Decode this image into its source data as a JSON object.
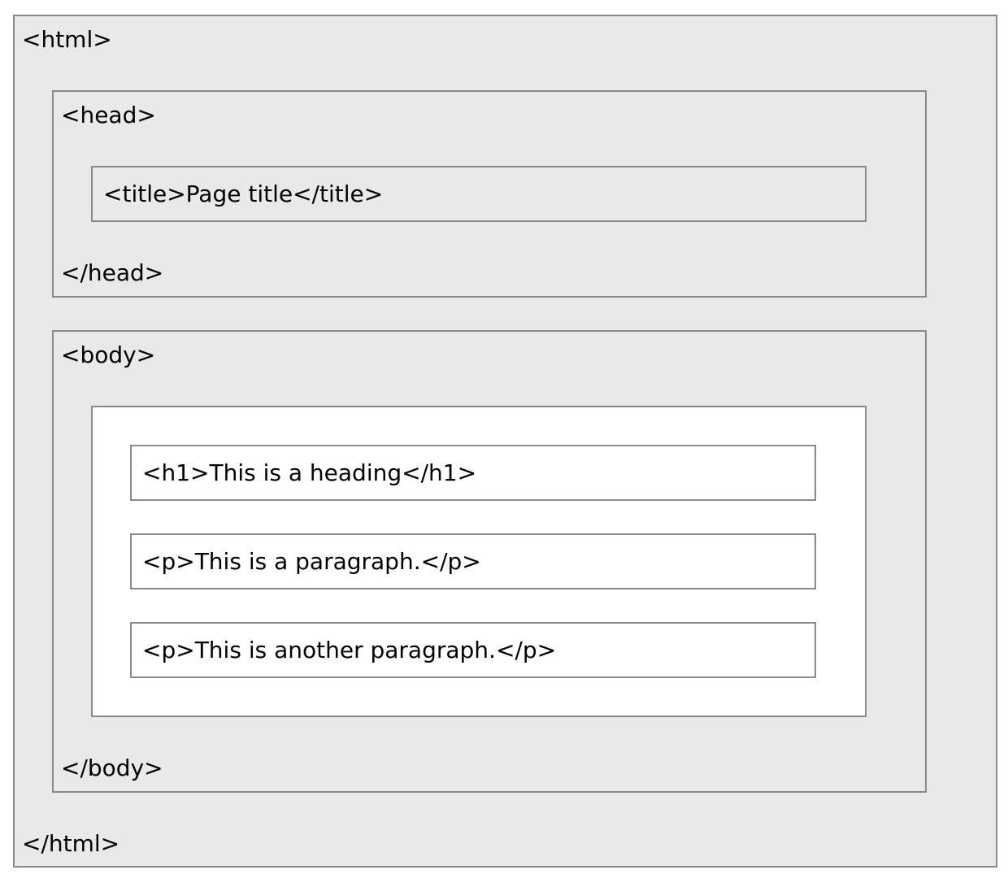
{
  "html": {
    "open_tag": "<html>",
    "close_tag": "</html>"
  },
  "head": {
    "open_tag": "<head>",
    "close_tag": "</head>",
    "title_element": "<title>Page title</title>"
  },
  "body": {
    "open_tag": "<body>",
    "close_tag": "</body>",
    "elements": [
      "<h1>This is a heading</h1>",
      "<p>This is a paragraph.</p>",
      "<p>This is another paragraph.</p>"
    ]
  },
  "colors": {
    "outer_fill": "#e8e9eb",
    "content_fill": "#ffffff",
    "border": "#8a8a8a",
    "text": "#000000"
  }
}
